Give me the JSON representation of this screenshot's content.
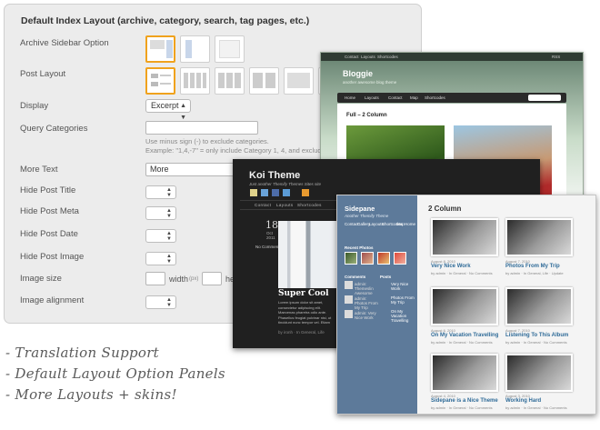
{
  "panel": {
    "title": "Default Index Layout (archive, category, search, tag pages, etc.)",
    "labels": {
      "archive_sidebar": "Archive Sidebar Option",
      "post_layout": "Post Layout",
      "display": "Display",
      "query_categories": "Query Categories",
      "more_text": "More Text",
      "hide_title": "Hide Post Title",
      "hide_meta": "Hide Post Meta",
      "hide_date": "Hide Post Date",
      "hide_image": "Hide Post Image",
      "image_size": "Image size",
      "image_alignment": "Image alignment"
    },
    "display_value": "Excerpt",
    "query_hint1": "Use minus sign (-) to exclude categories.",
    "query_hint2": "Example: \"1,4,-7\" = only include Category 1, 4, and exclude C",
    "more_value": "More",
    "width_label": "width",
    "px_label": "(px)",
    "height_label": "he"
  },
  "bloggie": {
    "nav": [
      "Contact",
      "Layouts",
      "Shortcodes"
    ],
    "rss": "RSS",
    "title": "Bloggie",
    "tagline": "another awesome blog theme",
    "menu": [
      "Home",
      "Layouts",
      "Contact",
      "Map",
      "Shortcodes"
    ],
    "heading": "Full – 2 Column"
  },
  "koi": {
    "title": "Koi Theme",
    "tagline": "Just another Themify Themes Sites site",
    "menu": [
      "Contact",
      "Layouts",
      "Shortcodes"
    ],
    "date_day": "18",
    "date_month": "Oct",
    "date_year": "2011",
    "comments": "No Comments",
    "post_title": "Super Cool",
    "body": "Lorem ipsum dolor sit amet, consectetur adipiscing elit. Maecenas pharetra odio ante. Phasellus feugiat pulvinar nisi, ut tincidunt nunc tempor vel. Etiam consectetur magna. Nullam condimentum at ante.",
    "meta": "by ironh · In General, Life"
  },
  "sidepane": {
    "title": "Sidepane",
    "tagline": "Another Themify Theme",
    "menu": [
      "Contact",
      "Gallery",
      "Layouts",
      "Shortcodes",
      "Map",
      "Home"
    ],
    "recent_photos": "Recent Photos",
    "comments_head": "Comments",
    "posts_head": "Posts",
    "comment_items": [
      "admin: Themeslin Awesome",
      "admin: Photos From My Trip",
      "admin: Very Nice Work"
    ],
    "post_items": [
      "Very Nice Work",
      "Photos From My Trip",
      "On My Vacation Travelling"
    ],
    "heading": "2 Column",
    "posts": [
      {
        "date": "August 8, 2010",
        "title": "Very Nice Work",
        "meta": "by admin · In General · No Comments"
      },
      {
        "date": "August 7, 2010",
        "title": "Photos From My Trip",
        "meta": "by admin · In General, Life · Update"
      },
      {
        "date": "August 6, 2010",
        "title": "On My Vacation Travelling",
        "meta": "by admin · In General · No Comments"
      },
      {
        "date": "August 7, 2010",
        "title": "Listening To This Album",
        "meta": "by admin · In General · No Comments"
      },
      {
        "date": "August 4, 2010",
        "title": "Sidepane is a Nice Theme",
        "meta": "by admin · In General · No Comments"
      },
      {
        "date": "August 3, 2010",
        "title": "Working Hard",
        "meta": "by admin · In General · No Comments"
      }
    ]
  },
  "features": [
    "- Translation Support",
    "- Default Layout Option Panels",
    "- More Layouts + skins!"
  ]
}
